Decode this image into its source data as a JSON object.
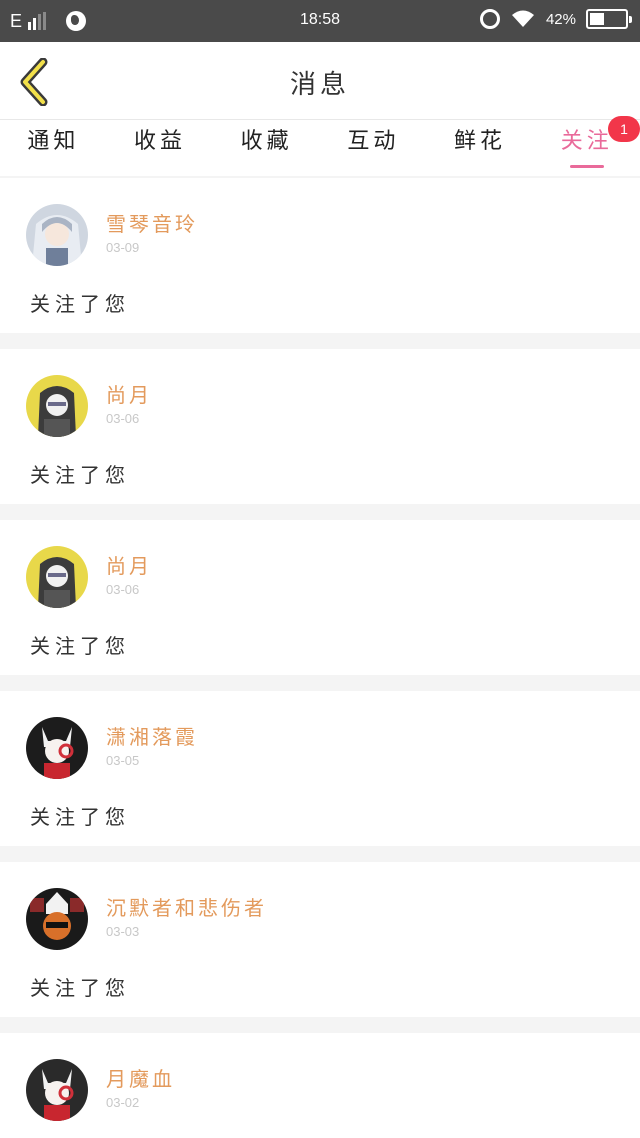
{
  "status_bar": {
    "carrier": "E",
    "time": "18:58",
    "battery_percent": "42%",
    "battery_level": 0.42,
    "icons": [
      "signal-icon",
      "globe-icon",
      "alarm-icon",
      "wifi-icon",
      "battery-icon"
    ]
  },
  "header": {
    "title": "消息",
    "back_icon": "chevron-left-icon"
  },
  "tabs": [
    {
      "label": "通知"
    },
    {
      "label": "收益"
    },
    {
      "label": "收藏"
    },
    {
      "label": "互动"
    },
    {
      "label": "鲜花"
    },
    {
      "label": "关注",
      "active": true,
      "badge": "1"
    }
  ],
  "colors": {
    "accent": "#e96a9a",
    "badge": "#f2364a",
    "nickname": "#e39a5c",
    "status_bar": "#4a4a4a"
  },
  "notifications": [
    {
      "nickname": "雪琴音玲",
      "date": "03-09",
      "message": "关注了您"
    },
    {
      "nickname": "尚月",
      "date": "03-06",
      "message": "关注了您"
    },
    {
      "nickname": "尚月",
      "date": "03-06",
      "message": "关注了您"
    },
    {
      "nickname": "潇湘落霞",
      "date": "03-05",
      "message": "关注了您"
    },
    {
      "nickname": "沉默者和悲伤者",
      "date": "03-03",
      "message": "关注了您"
    },
    {
      "nickname": "月魔血",
      "date": "03-02",
      "message": ""
    }
  ]
}
